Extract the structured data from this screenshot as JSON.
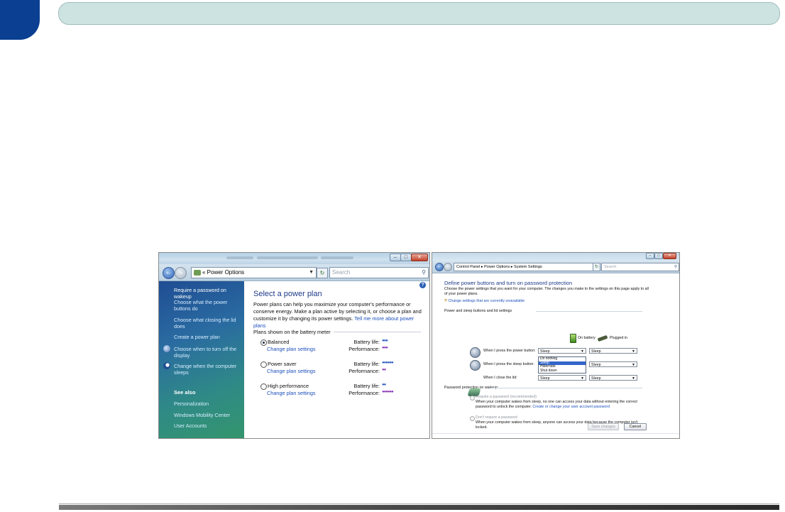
{
  "page": {
    "header_bar": "",
    "chapter_tab": ""
  },
  "window1": {
    "address": "Power Options",
    "search_placeholder": "Search",
    "sidebar": {
      "items": [
        "Require a password on wakeup",
        "Choose what the power buttons do",
        "Choose what closing the lid does",
        "Create a power plan",
        "Choose when to turn off the display",
        "Change when the computer sleeps"
      ],
      "see_also_title": "See also",
      "see_also": [
        "Personalization",
        "Windows Mobility Center",
        "User Accounts"
      ]
    },
    "main": {
      "title": "Select a power plan",
      "description": "Power plans can help you maximize your computer's performance or conserve energy. Make a plan active by selecting it, or choose a plan and customize it by changing its power settings.",
      "description_link": "Tell me more about power plans",
      "plans_header": "Plans shown on the battery meter",
      "battery_label": "Battery life:",
      "performance_label": "Performance:",
      "change_label": "Change plan settings",
      "plans": [
        {
          "name": "Balanced",
          "selected": true,
          "battery_dots": 3,
          "performance_dots": 3
        },
        {
          "name": "Power saver",
          "selected": false,
          "battery_dots": 6,
          "performance_dots": 2
        },
        {
          "name": "High performance",
          "selected": false,
          "battery_dots": 2,
          "performance_dots": 6
        }
      ]
    }
  },
  "window2": {
    "address": "Control Panel ▸ Power Options ▸ System Settings",
    "search_placeholder": "Search",
    "title": "Define power buttons and turn on password protection",
    "intro": "Choose the power settings that you want for your computer. The changes you make to the settings on this page apply to all of your power plans.",
    "unavailable_link": "Change settings that are currently unavailable",
    "section1": "Power and sleep buttons and lid settings",
    "col_battery": "On battery",
    "col_plugged": "Plugged in",
    "rows": [
      {
        "label": "When I press the power button:",
        "battery": "Sleep",
        "plugged": "Sleep"
      },
      {
        "label": "When I press the sleep button:",
        "battery": "Sleep",
        "plugged": "Sleep"
      },
      {
        "label": "When I close the lid:",
        "battery": "Sleep",
        "plugged": "Sleep"
      }
    ],
    "dropdown_options": [
      "Do nothing",
      "Sleep",
      "Hibernate",
      "Shut down"
    ],
    "dropdown_highlight": "Sleep",
    "section2": "Password protection on wakeup",
    "require_label": "Require a password (recommended)",
    "require_desc": "When your computer wakes from sleep, no one can access your data without entering the correct password to unlock the computer.",
    "require_link": "Create or change your user account password",
    "dont_label": "Don't require a password",
    "dont_desc": "When your computer wakes from sleep, anyone can access your data because the computer isn't locked.",
    "save_button": "Save changes",
    "cancel_button": "Cancel"
  }
}
